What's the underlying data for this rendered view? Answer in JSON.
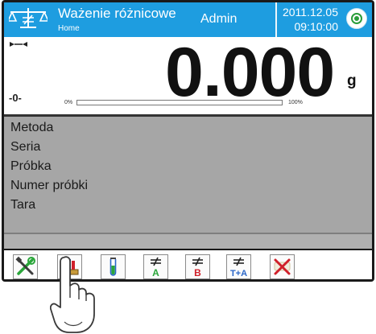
{
  "header": {
    "title": "Ważenie różnicowe",
    "subtitle": "Home",
    "user": "Admin",
    "date": "2011.12.05",
    "time": "09:10:00"
  },
  "weighing": {
    "zero_indicator": "-0-",
    "value": "0.000",
    "unit": "g",
    "bar_min_label": "0%",
    "bar_max_label": "100%",
    "bar_level_percent": 0
  },
  "info": {
    "items": [
      "Metoda",
      "Seria",
      "Próbka",
      "Numer próbki",
      "Tara"
    ]
  },
  "toolbar": {
    "buttons": [
      {
        "icon": "settings-tools-icon"
      },
      {
        "icon": "sample-series-icon"
      },
      {
        "icon": "test-tube-icon"
      },
      {
        "icon": "differential-a-icon",
        "label": "A"
      },
      {
        "icon": "differential-b-icon",
        "label": "B"
      },
      {
        "icon": "differential-ta-icon",
        "label": "T+A"
      },
      {
        "icon": "cancel-differential-icon"
      }
    ]
  },
  "colors": {
    "header_blue": "#1e9de0",
    "info_gray": "#a6a6a6",
    "status_green": "#2a9d3a",
    "icon_green": "#2aa63a",
    "icon_red": "#d0202a",
    "icon_blue": "#2a66c8"
  }
}
